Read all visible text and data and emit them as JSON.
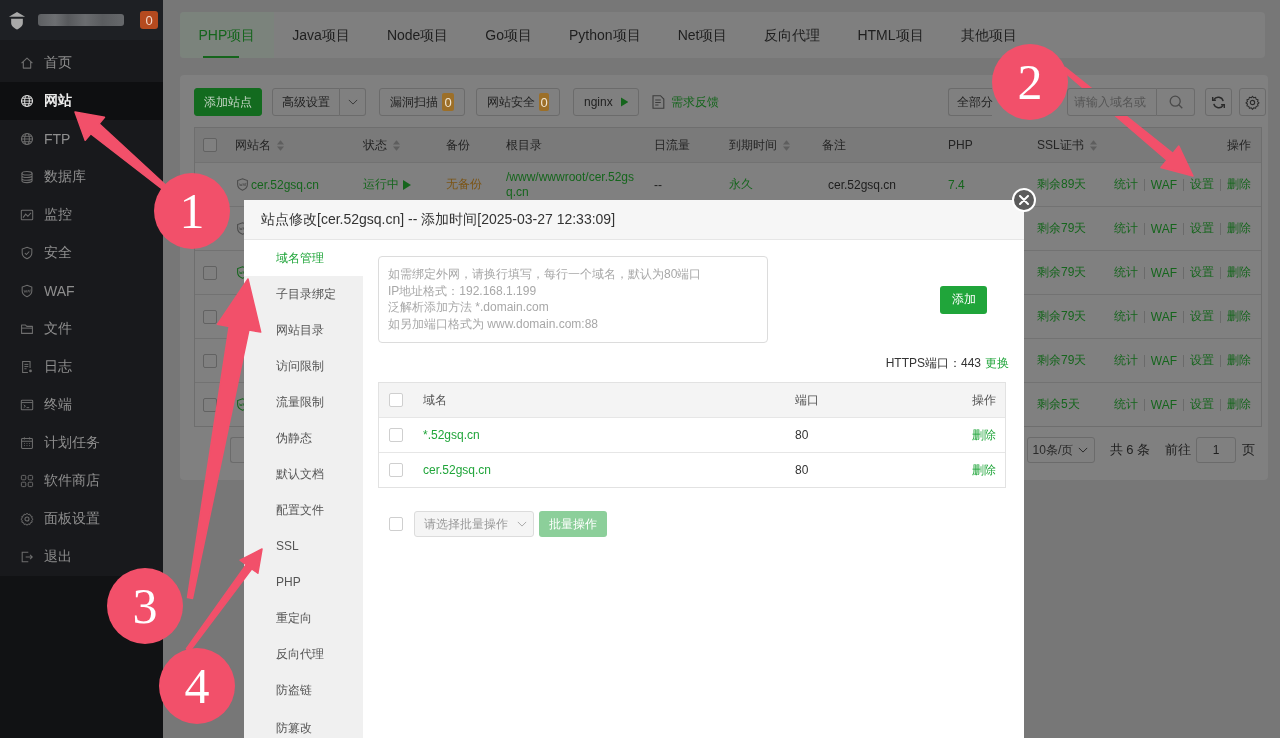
{
  "sidebar": {
    "badge": "0",
    "items": [
      {
        "label": "首页",
        "selected": false
      },
      {
        "label": "网站",
        "selected": true
      },
      {
        "label": "FTP",
        "selected": false
      },
      {
        "label": "数据库",
        "selected": false
      },
      {
        "label": "监控",
        "selected": false
      },
      {
        "label": "安全",
        "selected": false
      },
      {
        "label": "WAF",
        "selected": false
      },
      {
        "label": "文件",
        "selected": false
      },
      {
        "label": "日志",
        "selected": false
      },
      {
        "label": "终端",
        "selected": false
      },
      {
        "label": "计划任务",
        "selected": false
      },
      {
        "label": "软件商店",
        "selected": false
      },
      {
        "label": "面板设置",
        "selected": false
      },
      {
        "label": "退出",
        "selected": false
      }
    ]
  },
  "tabs": [
    {
      "label": "PHP项目",
      "selected": true
    },
    {
      "label": "Java项目",
      "selected": false
    },
    {
      "label": "Node项目",
      "selected": false
    },
    {
      "label": "Go项目",
      "selected": false
    },
    {
      "label": "Python项目",
      "selected": false
    },
    {
      "label": "Net项目",
      "selected": false
    },
    {
      "label": "反向代理",
      "selected": false
    },
    {
      "label": "HTML项目",
      "selected": false
    },
    {
      "label": "其他项目",
      "selected": false
    }
  ],
  "toolbar": {
    "add_site": "添加站点",
    "advanced": "高级设置",
    "buttons": [
      {
        "label": "漏洞扫描",
        "count": "0"
      },
      {
        "label": "网站安全",
        "count": "0"
      }
    ],
    "server": "nginx",
    "feedback": "需求反馈",
    "category": "全部分",
    "search": {
      "placeholder": "请输入域名或"
    }
  },
  "site_table": {
    "all_checked": false,
    "columns": [
      {
        "label": "网站名",
        "sortable": true
      },
      {
        "label": "状态",
        "sortable": true
      },
      {
        "label": "备份",
        "sortable": false
      },
      {
        "label": "根目录",
        "sortable": false
      },
      {
        "label": "日流量",
        "sortable": false
      },
      {
        "label": "到期时间",
        "sortable": true
      },
      {
        "label": "备注",
        "sortable": false
      },
      {
        "label": "PHP",
        "sortable": false
      },
      {
        "label": "SSL证书",
        "sortable": true
      },
      {
        "label": "操作",
        "sortable": false
      }
    ],
    "rows": [
      {
        "waf": false,
        "name": "cer.52gsq.cn",
        "status": "运行中",
        "backup": "无备份",
        "root": "/www/wwwroot/cer.52gsq.cn",
        "traffic": "--",
        "expiry": "永久",
        "note": "cer.52gsq.cn",
        "php": "7.4",
        "ssl": "剩余89天",
        "actions": [
          "统计",
          "WAF",
          "设置",
          "删除"
        ]
      },
      {
        "waf": false,
        "ssl": "剩余79天",
        "actions": [
          "统计",
          "WAF",
          "设置",
          "删除"
        ]
      },
      {
        "checked": false,
        "waf": true,
        "ssl": "剩余79天",
        "actions": [
          "统计",
          "WAF",
          "设置",
          "删除"
        ]
      },
      {
        "checked": false,
        "ssl": "剩余79天",
        "actions": [
          "统计",
          "WAF",
          "设置",
          "删除"
        ]
      },
      {
        "checked": false,
        "ssl": "剩余79天",
        "actions": [
          "统计",
          "WAF",
          "设置",
          "删除"
        ]
      },
      {
        "checked": false,
        "waf": true,
        "ssl": "剩余5天",
        "actions": [
          "统计",
          "WAF",
          "设置",
          "删除"
        ]
      }
    ]
  },
  "pagination": {
    "page_size": "10条/页",
    "total": "共 6 条",
    "goto": "前往",
    "page": "1",
    "unit": "页"
  },
  "modal": {
    "title": "站点修改[cer.52gsq.cn] -- 添加时间[2025-03-27 12:33:09]",
    "nav": [
      {
        "label": "域名管理",
        "selected": true
      },
      {
        "label": "子目录绑定",
        "selected": false
      },
      {
        "label": "网站目录",
        "selected": false
      },
      {
        "label": "访问限制",
        "selected": false
      },
      {
        "label": "流量限制",
        "selected": false
      },
      {
        "label": "伪静态",
        "selected": false
      },
      {
        "label": "默认文档",
        "selected": false
      },
      {
        "label": "配置文件",
        "selected": false
      },
      {
        "label": "SSL",
        "selected": false
      },
      {
        "label": "PHP",
        "selected": false
      },
      {
        "label": "重定向",
        "selected": false
      },
      {
        "label": "反向代理",
        "selected": false
      },
      {
        "label": "防盗链",
        "selected": false
      },
      {
        "label": "防篡改",
        "selected": false
      }
    ],
    "domain_input": {
      "placeholder": "如需绑定外网，请换行填写，每行一个域名，默认为80端口\nIP地址格式：192.168.1.199\n泛解析添加方法 *.domain.com\n如另加端口格式为 www.domain.com:88"
    },
    "add_button": "添加",
    "https_port": "HTTPS端口：443",
    "https_change": "更换",
    "domain_table": {
      "all_checked": false,
      "columns": [
        "域名",
        "端口",
        "操作"
      ],
      "rows": [
        {
          "checked": false,
          "domain": "*.52gsq.cn",
          "port": "80",
          "action": "删除"
        },
        {
          "checked": false,
          "domain": "cer.52gsq.cn",
          "port": "80",
          "action": "删除"
        }
      ]
    },
    "batch": {
      "checked": false,
      "placeholder": "请选择批量操作",
      "button": "批量操作"
    }
  },
  "annotations": [
    {
      "label": "1"
    },
    {
      "label": "2"
    },
    {
      "label": "3"
    },
    {
      "label": "4"
    }
  ]
}
